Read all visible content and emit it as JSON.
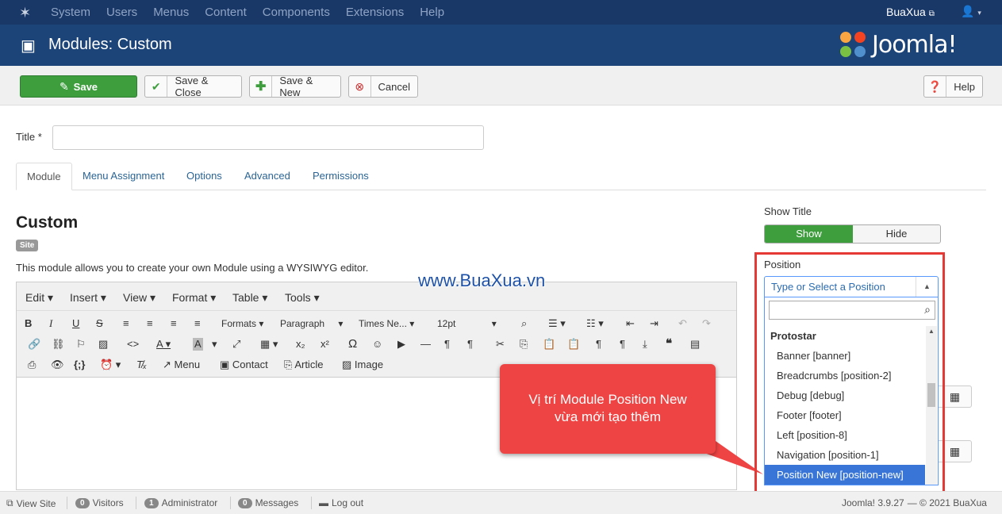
{
  "topnav": {
    "menu": [
      "System",
      "Users",
      "Menus",
      "Content",
      "Components",
      "Extensions",
      "Help"
    ],
    "user": "BuaXua"
  },
  "header": {
    "title": "Modules: Custom",
    "brand": "Joomla!"
  },
  "toolbar": {
    "save": "Save",
    "save_close": "Save & Close",
    "save_new": "Save & New",
    "cancel": "Cancel",
    "help": "Help"
  },
  "form": {
    "title_label": "Title *",
    "title_value": ""
  },
  "tabs": [
    "Module",
    "Menu Assignment",
    "Options",
    "Advanced",
    "Permissions"
  ],
  "module": {
    "name": "Custom",
    "badge": "Site",
    "description": "This module allows you to create your own Module using a WYSIWYG editor."
  },
  "watermark": "www.BuaXua.vn",
  "editor": {
    "menus": [
      "Edit",
      "Insert",
      "View",
      "Format",
      "Table",
      "Tools"
    ],
    "formats": "Formats",
    "paragraph": "Paragraph",
    "font": "Times Ne...",
    "size": "12pt",
    "buttons": {
      "menu": "Menu",
      "contact": "Contact",
      "article": "Article",
      "image": "Image"
    }
  },
  "callout": {
    "line1": "Vị trí Module Position New",
    "line2": "vừa mới tạo thêm"
  },
  "sidebar": {
    "show_title_label": "Show Title",
    "show": "Show",
    "hide": "Hide",
    "position_label": "Position",
    "position_placeholder": "Type or Select a Position",
    "group": "Protostar",
    "options": [
      "Banner [banner]",
      "Breadcrumbs [position-2]",
      "Debug [debug]",
      "Footer [footer]",
      "Left [position-8]",
      "Navigation [position-1]",
      "Position New [position-new]"
    ]
  },
  "footer": {
    "view_site": "View Site",
    "visitors_count": "0",
    "visitors": "Visitors",
    "admin_count": "1",
    "admin": "Administrator",
    "messages_count": "0",
    "messages": "Messages",
    "logout": "Log out",
    "version": "Joomla! 3.9.27",
    "copyright": "— © 2021 BuaXua"
  },
  "colors": {
    "nav": "#1a3867",
    "header": "#1d4479",
    "save": "#3e9e3e",
    "selected": "#3875d7",
    "callout": "#ef4444"
  }
}
